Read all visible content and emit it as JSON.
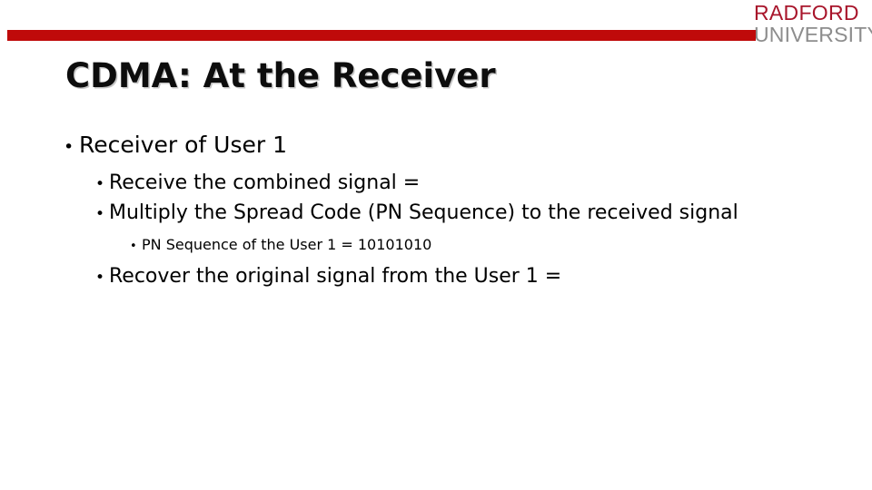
{
  "branding": {
    "logo_line1": "RADFORD",
    "logo_line2": "UNIVERSITY",
    "logo_red": "#a8152b",
    "logo_gray": "#8d8d8d",
    "bar_color": "#bf0a0a"
  },
  "slide": {
    "title": "CDMA: At the Receiver",
    "bullets": [
      {
        "level": 1,
        "marker": "•",
        "text": "Receiver of User 1"
      },
      {
        "level": 2,
        "marker": "•",
        "text": "Receive the combined signal ="
      },
      {
        "level": 2,
        "marker": "•",
        "text": "Multiply the Spread Code (PN Sequence) to the received signal"
      },
      {
        "level": 3,
        "marker": "•",
        "text": "PN Sequence of the User 1 = 10101010"
      },
      {
        "level": 2,
        "marker": "•",
        "text": "Recover the original signal from the User 1 ="
      }
    ]
  }
}
